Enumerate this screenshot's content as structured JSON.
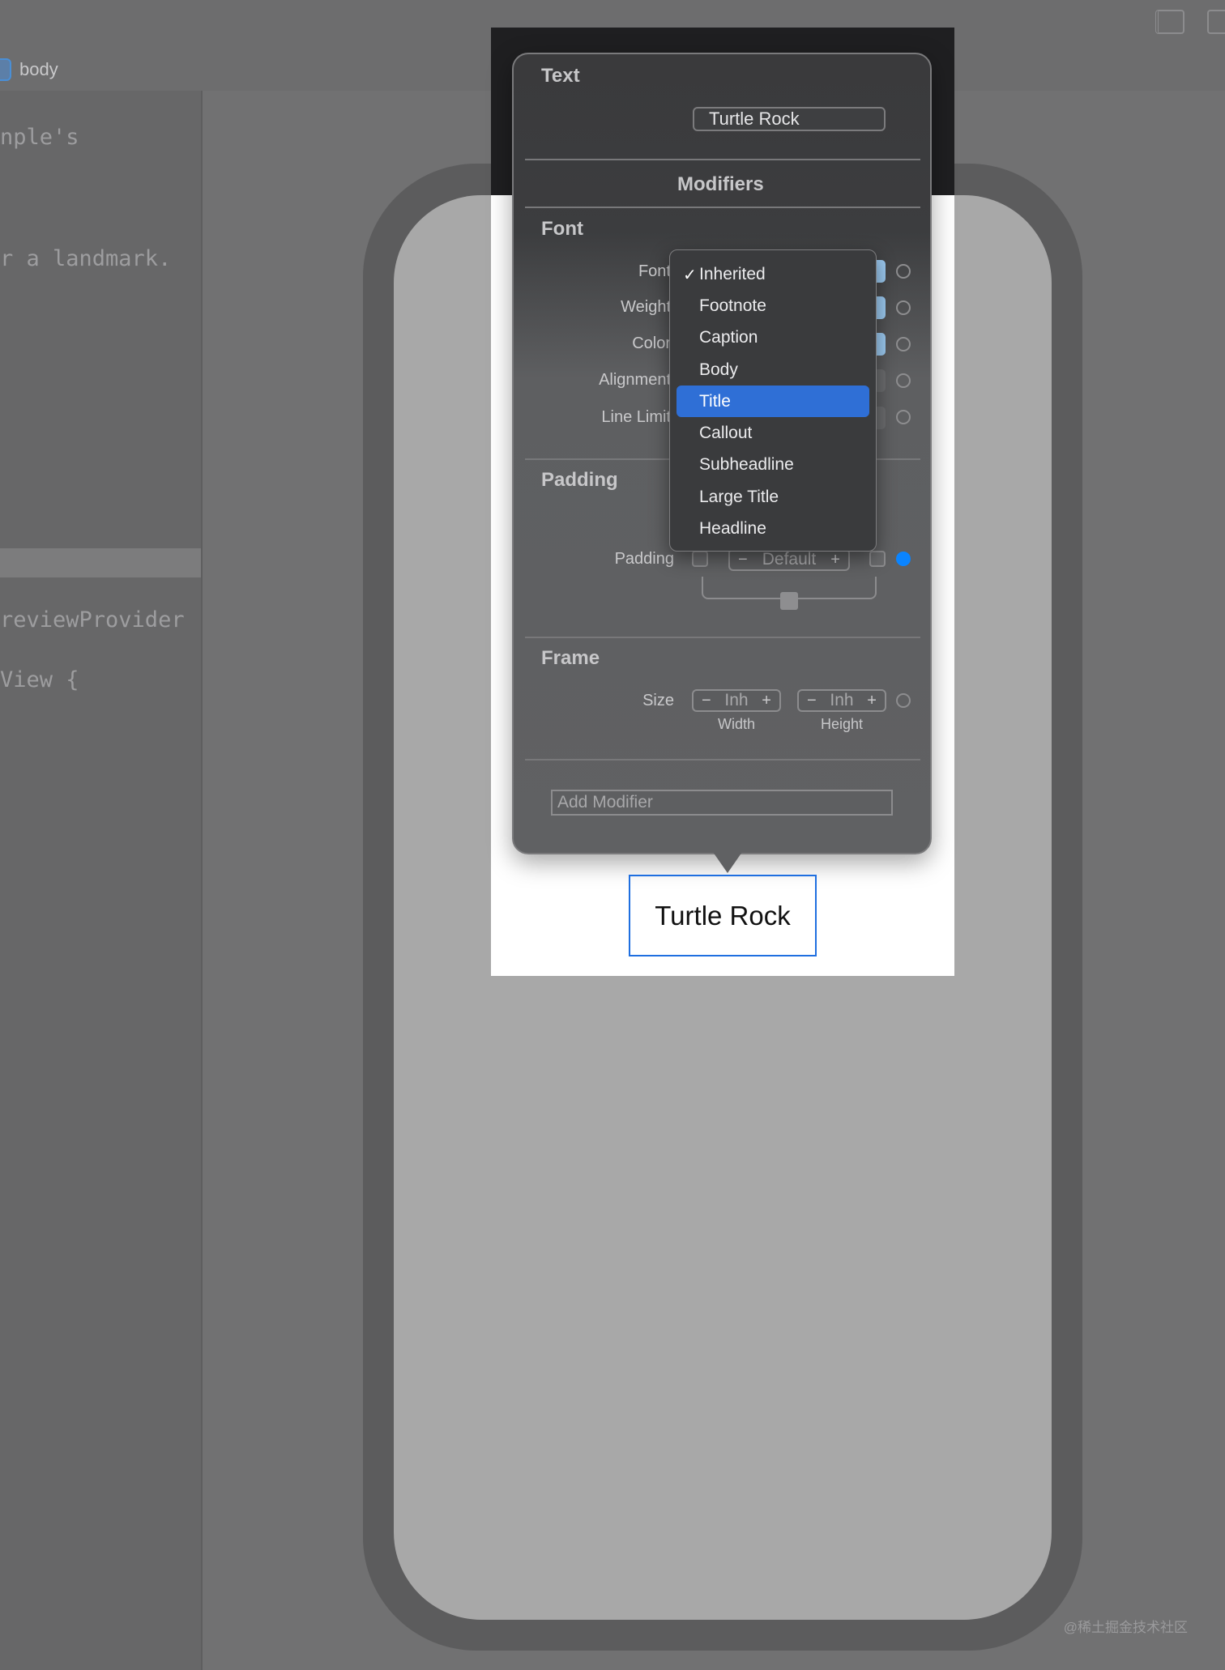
{
  "breadcrumb": {
    "label": "body"
  },
  "code": {
    "line1": "nple's",
    "line2": "r a landmark.",
    "line3": "reviewProvider",
    "line4": "View {"
  },
  "inspector": {
    "text_section_title": "Text",
    "text_value": "Turtle Rock",
    "modifiers_title": "Modifiers",
    "font_section_title": "Font",
    "font_rows": [
      "Font",
      "Weight",
      "Color",
      "Alignment",
      "Line Limit"
    ],
    "padding_section_title": "Padding",
    "padding_label": "Padding",
    "padding_stepper": {
      "minus": "−",
      "value": "Default",
      "plus": "+"
    },
    "frame_section_title": "Frame",
    "size_label": "Size",
    "width_stepper": {
      "minus": "−",
      "value": "Inh",
      "plus": "+"
    },
    "height_stepper": {
      "minus": "−",
      "value": "Inh",
      "plus": "+"
    },
    "width_label": "Width",
    "height_label": "Height",
    "add_modifier_placeholder": "Add Modifier"
  },
  "font_menu": {
    "checked": "Inherited",
    "highlighted": "Title",
    "items": [
      "Inherited",
      "Footnote",
      "Caption",
      "Body",
      "Title",
      "Callout",
      "Subheadline",
      "Large Title",
      "Headline"
    ]
  },
  "preview": {
    "label": "Turtle Rock"
  },
  "watermark": "@稀土掘金技术社区",
  "colors": {
    "accent": "#0a84ff",
    "menu_highlight": "#2f6fd6",
    "selection_border": "#1f6fe0"
  },
  "icons": {
    "check": "✓"
  }
}
